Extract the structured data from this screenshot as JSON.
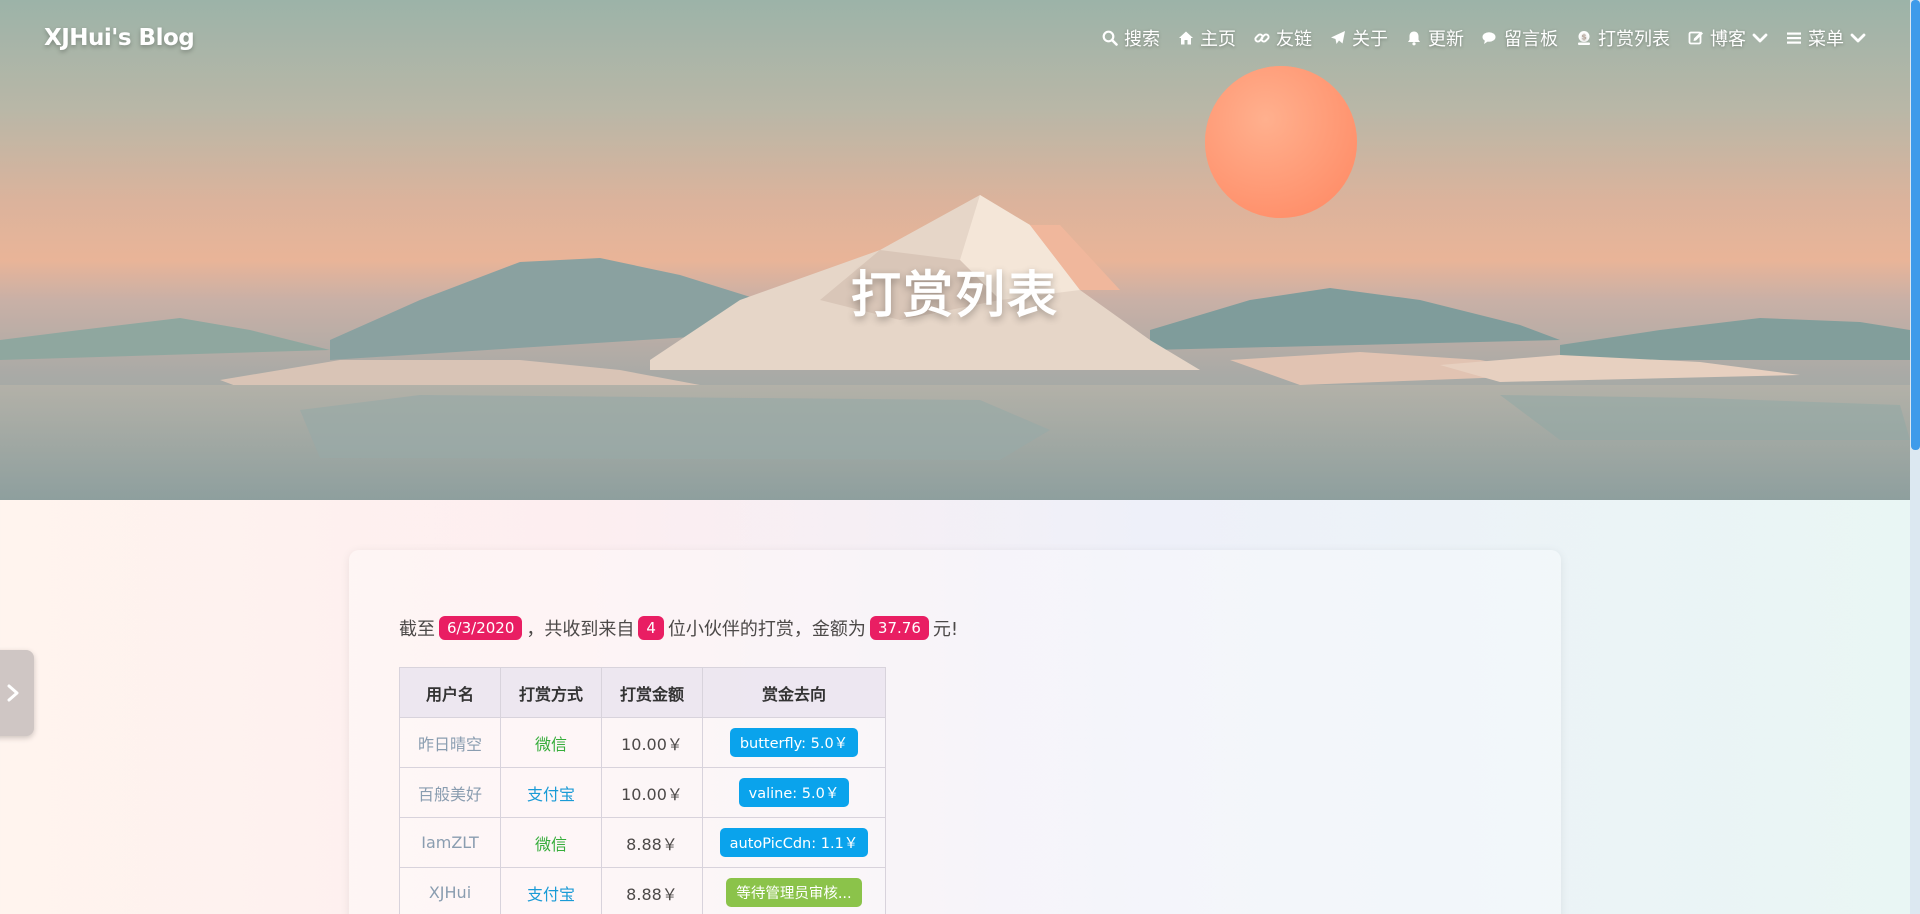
{
  "site": {
    "brand": "XJHui's Blog"
  },
  "nav": {
    "items": [
      {
        "label": "搜索",
        "icon": "search-icon"
      },
      {
        "label": "主页",
        "icon": "home-icon"
      },
      {
        "label": "友链",
        "icon": "link-icon"
      },
      {
        "label": "关于",
        "icon": "paper-plane-icon"
      },
      {
        "label": "更新",
        "icon": "bell-icon"
      },
      {
        "label": "留言板",
        "icon": "comments-icon"
      },
      {
        "label": "打赏列表",
        "icon": "donate-icon"
      },
      {
        "label": "博客",
        "icon": "edit-icon"
      },
      {
        "label": "菜单",
        "icon": "bars-icon"
      }
    ]
  },
  "hero": {
    "title": "打赏列表"
  },
  "summary": {
    "prefix": "截至",
    "date": "6/3/2020",
    "middle1": "，共收到来自",
    "count": "4",
    "middle2": "位小伙伴的打赏，金额为",
    "amount": "37.76",
    "suffix": "元!"
  },
  "table": {
    "headers": [
      "用户名",
      "打赏方式",
      "打赏金额",
      "赏金去向"
    ],
    "rows": [
      {
        "user": "昨日晴空",
        "method": "微信",
        "amount": "10.00￥",
        "dest": "butterfly: 5.0￥"
      },
      {
        "user": "百般美好",
        "method": "支付宝",
        "amount": "10.00￥",
        "dest": "valine: 5.0￥"
      },
      {
        "user": "IamZLT",
        "method": "微信",
        "amount": "8.88￥",
        "dest": "autoPicCdn: 1.1￥"
      },
      {
        "user": "XJHui",
        "method": "支付宝",
        "amount": "8.88￥",
        "dest": "等待管理员审核..."
      }
    ]
  },
  "colors": {
    "pill": "#e91e63",
    "wechat": "#36ad3b",
    "alipay": "#1a9bd6",
    "dest_blue": "#0aa3ec",
    "dest_green": "#8bc34a",
    "scroll_thumb": "#3e9bea"
  }
}
